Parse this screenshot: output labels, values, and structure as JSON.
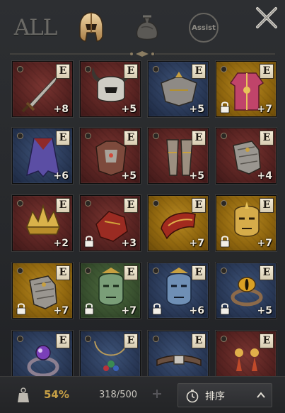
{
  "topbar": {
    "filter_all_label": "ALL",
    "filter_assist_label": "Assist"
  },
  "colors": {
    "red_slot": "#5a2422",
    "blue_slot": "#2b3b5a",
    "gold_slot": "#92680f",
    "green_slot": "#3a5230",
    "weight_text": "#c7a046"
  },
  "items": [
    {
      "level": "+8",
      "badge": "E",
      "rarity": "red",
      "art": "sword-icon",
      "locked": false
    },
    {
      "level": "+5",
      "badge": "E",
      "rarity": "red",
      "art": "horned-helmet-icon",
      "locked": false
    },
    {
      "level": "+5",
      "badge": "E",
      "rarity": "blue",
      "art": "pauldrons-icon",
      "locked": false
    },
    {
      "level": "+7",
      "badge": "E",
      "rarity": "gold",
      "art": "robe-icon",
      "locked": true
    },
    {
      "level": "+6",
      "badge": "E",
      "rarity": "blue",
      "art": "cloak-icon",
      "locked": false
    },
    {
      "level": "+5",
      "badge": "E",
      "rarity": "red",
      "art": "chest-armor-icon",
      "locked": false
    },
    {
      "level": "+5",
      "badge": "E",
      "rarity": "red",
      "art": "leg-armor-icon",
      "locked": false
    },
    {
      "level": "+4",
      "badge": "E",
      "rarity": "red",
      "art": "gauntlet-icon",
      "locked": false
    },
    {
      "level": "+2",
      "badge": "E",
      "rarity": "red",
      "art": "crown-icon",
      "locked": false
    },
    {
      "level": "+3",
      "badge": "E",
      "rarity": "red",
      "art": "bracer-icon",
      "locked": true
    },
    {
      "level": "+7",
      "badge": "E",
      "rarity": "gold",
      "art": "shoulder-guard-icon",
      "locked": false
    },
    {
      "level": "+7",
      "badge": "E",
      "rarity": "gold",
      "art": "mask-icon",
      "locked": true
    },
    {
      "level": "+7",
      "badge": "E",
      "rarity": "gold",
      "art": "gauntlet-icon",
      "locked": true
    },
    {
      "level": "+7",
      "badge": "E",
      "rarity": "green",
      "art": "jade-mask-icon",
      "locked": true
    },
    {
      "level": "+6",
      "badge": "E",
      "rarity": "blue",
      "art": "blue-mask-icon",
      "locked": true
    },
    {
      "level": "+5",
      "badge": "E",
      "rarity": "blue",
      "art": "eye-ring-icon",
      "locked": true
    },
    {
      "level": "",
      "badge": "E",
      "rarity": "blue",
      "art": "gem-ring-icon",
      "locked": false
    },
    {
      "level": "",
      "badge": "E",
      "rarity": "blue",
      "art": "necklace-icon",
      "locked": false
    },
    {
      "level": "",
      "badge": "E",
      "rarity": "blue",
      "art": "belt-icon",
      "locked": false
    },
    {
      "level": "",
      "badge": "E",
      "rarity": "red",
      "art": "earrings-icon",
      "locked": false
    }
  ],
  "bottombar": {
    "weight_percent": "54%",
    "capacity": "318/500",
    "sort_label": "排序"
  }
}
